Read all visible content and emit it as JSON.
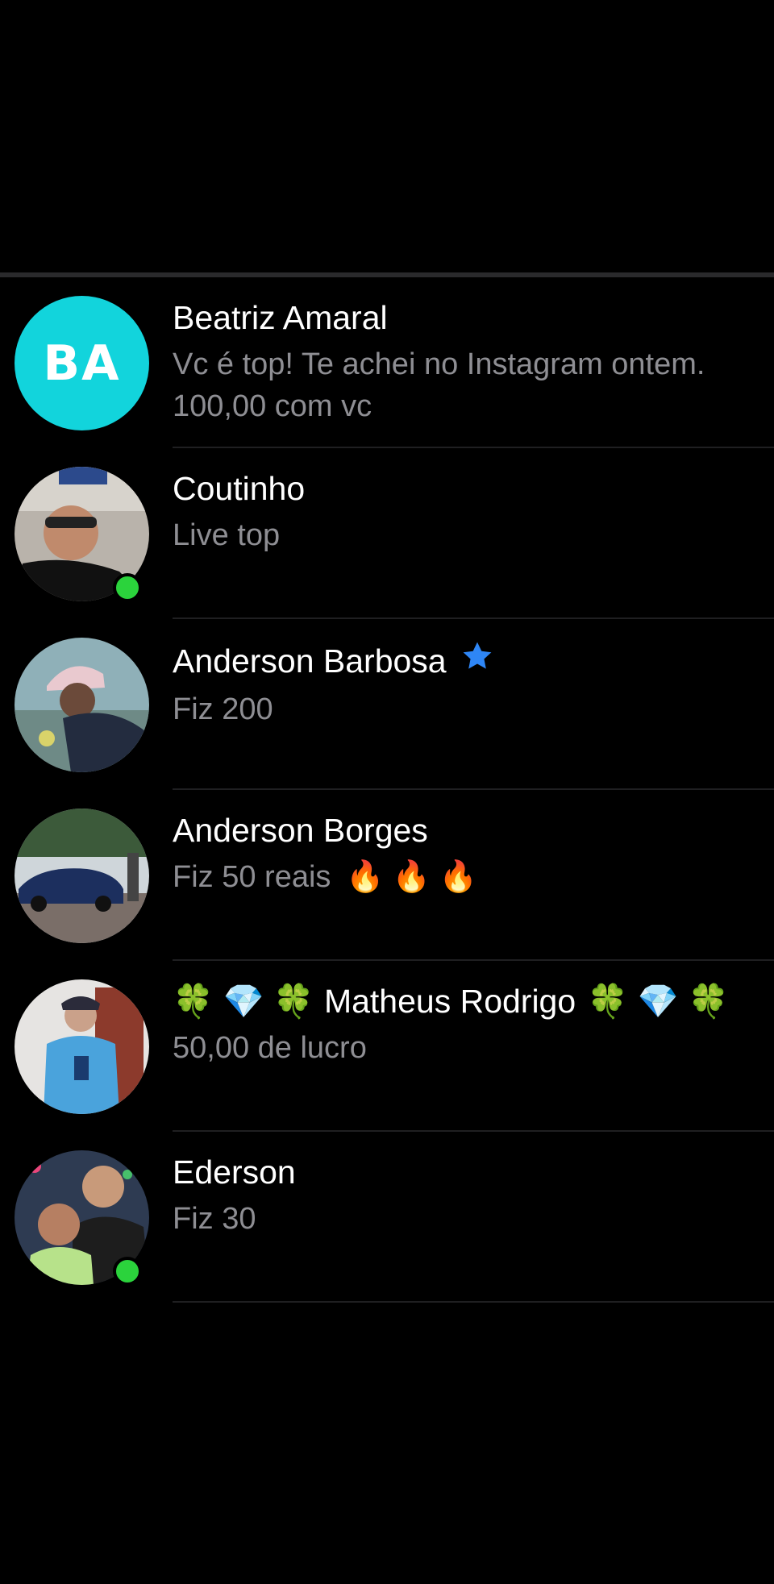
{
  "chats": [
    {
      "name": "Beatriz Amaral",
      "initials": "BA",
      "preview_line1": "Vc é top! Te achei no Instagram ontem.",
      "preview_line2": "100,00 com vc",
      "online": false
    },
    {
      "name": "Coutinho",
      "preview": "Live top",
      "online": true,
      "avatar_icon": "user-photo"
    },
    {
      "name": "Anderson Barbosa",
      "preview": "Fiz 200",
      "online": false,
      "name_badge": "star-icon",
      "avatar_icon": "user-photo"
    },
    {
      "name": "Anderson Borges",
      "preview": "Fiz 50 reais",
      "preview_emoji": "🔥 🔥 🔥",
      "online": false,
      "avatar_icon": "user-photo"
    },
    {
      "name": "Matheus Rodrigo",
      "name_prefix_emoji": "🍀 💎 🍀",
      "name_suffix_emoji": "🍀 💎 🍀",
      "preview": "50,00 de lucro",
      "online": false,
      "avatar_icon": "user-photo"
    },
    {
      "name": "Ederson",
      "preview": "Fiz 30",
      "online": true,
      "avatar_icon": "user-photo"
    }
  ],
  "colors": {
    "background": "#000000",
    "initials_avatar": "#12d4dc",
    "online_dot": "#2bd33c",
    "preview_text": "#8e8e93",
    "star_badge": "#2e86f6"
  }
}
